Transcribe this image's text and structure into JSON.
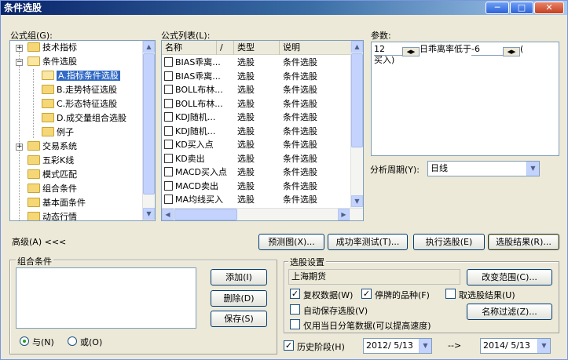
{
  "window": {
    "title": "条件选股",
    "controls": [
      "─",
      "□",
      "✕"
    ]
  },
  "formula_group": {
    "label": "公式组(G):",
    "items": [
      {
        "label": "技术指标",
        "expander": "+"
      },
      {
        "label": "条件选股",
        "expander": "−"
      },
      {
        "label": "A.指标条件选股",
        "selected": true
      },
      {
        "label": "B.走势特征选股"
      },
      {
        "label": "C.形态特征选股"
      },
      {
        "label": "D.成交量组合选股"
      },
      {
        "label": "例子"
      },
      {
        "label": "交易系统",
        "expander": "+"
      },
      {
        "label": "五彩K线"
      },
      {
        "label": "模式匹配"
      },
      {
        "label": "组合条件"
      },
      {
        "label": "基本面条件"
      },
      {
        "label": "动态行情"
      }
    ]
  },
  "formula_list": {
    "label": "公式列表(L):",
    "columns": [
      "名称",
      "/",
      "类型",
      "说明"
    ],
    "rows": [
      [
        "BIAS乖离...",
        "选股",
        "条件选股"
      ],
      [
        "BIAS乖离...",
        "选股",
        "条件选股"
      ],
      [
        "BOLL布林...",
        "选股",
        "条件选股"
      ],
      [
        "BOLL布林...",
        "选股",
        "条件选股"
      ],
      [
        "KDJ随机...",
        "选股",
        "条件选股"
      ],
      [
        "KDJ随机...",
        "选股",
        "条件选股"
      ],
      [
        "KD买入点",
        "选股",
        "条件选股"
      ],
      [
        "KD卖出",
        "选股",
        "条件选股"
      ],
      [
        "MACD买入点",
        "选股",
        "条件选股"
      ],
      [
        "MACD卖出",
        "选股",
        "条件选股"
      ],
      [
        "MA均线买入",
        "选股",
        "条件选股"
      ]
    ]
  },
  "params": {
    "label": "参数:",
    "value": "12",
    "text": "日乖离率低于",
    "value2": "-6",
    "suffix": "(",
    "line2": "买入)"
  },
  "period": {
    "label": "分析周期(Y):",
    "value": "日线"
  },
  "buttons": {
    "advanced": "高级(A) <<<",
    "preview": "预测图(X)...",
    "success_test": "成功率测试(T)...",
    "execute": "执行选股(E)",
    "results": "选股结果(R)...",
    "add": "添加(I)",
    "delete": "删除(D)",
    "save": "保存(S)",
    "change_range": "改变范围(C)...",
    "name_filter": "名称过滤(Z)..."
  },
  "combo_conditions": {
    "label": "组合条件",
    "and_label": "与(N)",
    "or_label": "或(O)",
    "and_selected": true
  },
  "settings": {
    "label": "选股设置",
    "range_value": "上海期货",
    "checkboxes": [
      {
        "label": "复权数据(W)",
        "checked": true
      },
      {
        "label": "停牌的品种(F)",
        "checked": true
      },
      {
        "label": "取选股结果(U)",
        "checked": false
      },
      {
        "label": "自动保存选股(V)",
        "checked": false
      },
      {
        "label": "仅用当日分笔数据(可以提高速度)",
        "checked": false
      }
    ],
    "history": {
      "label": "历史阶段(H)",
      "checked": true
    },
    "date_from": "2012/ 5/13",
    "arrow": "-->",
    "date_to": "2014/ 5/13"
  }
}
